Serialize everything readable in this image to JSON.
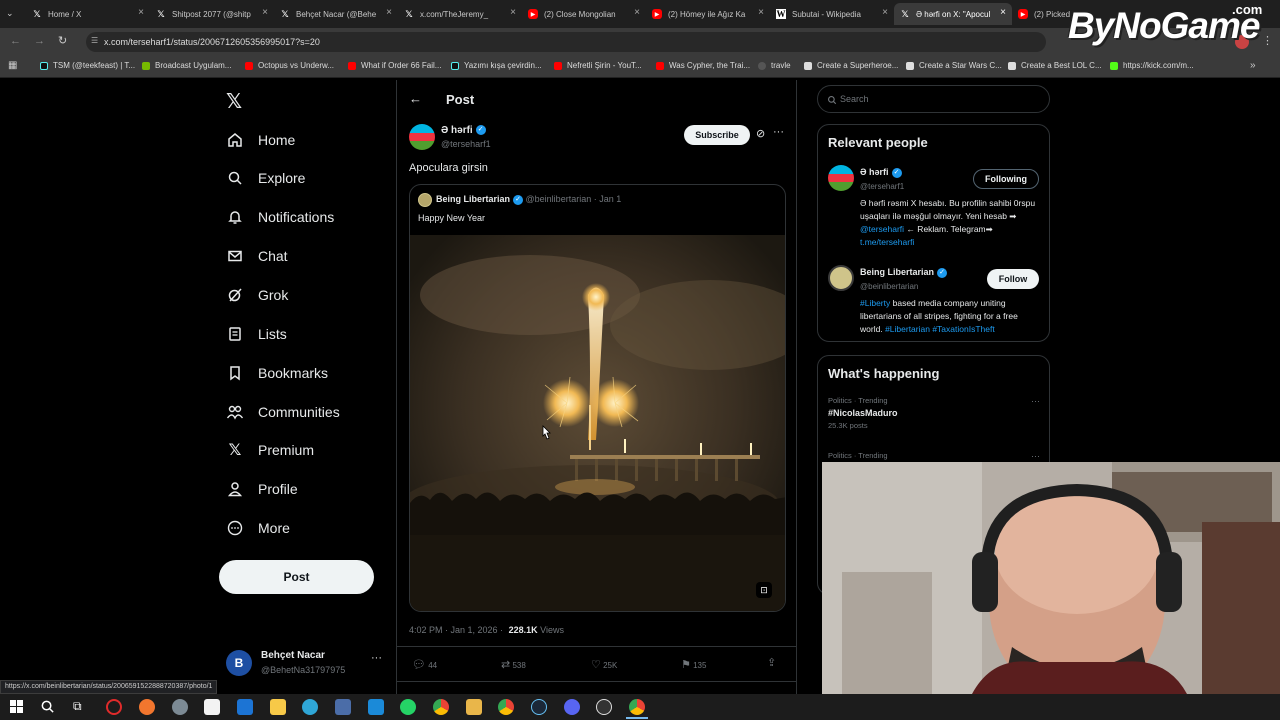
{
  "browser": {
    "tabs": [
      {
        "title": "Home / X",
        "fav": "x-icon",
        "color": "#000000"
      },
      {
        "title": "Shitpost 2077 (@shitp",
        "fav": "x-icon",
        "color": "#000000"
      },
      {
        "title": "Behçet Nacar (@Behe",
        "fav": "x-icon",
        "color": "#000000"
      },
      {
        "title": "x.com/TheJeremy_",
        "fav": "x-icon",
        "color": "#000000"
      },
      {
        "title": "(2) Close Mongolian",
        "fav": "youtube-icon",
        "color": "#ff0000"
      },
      {
        "title": "(2) Hömey ile Ağız Ka",
        "fav": "youtube-icon",
        "color": "#ff0000"
      },
      {
        "title": "Subutai - Wikipedia",
        "fav": "wikipedia-icon",
        "color": "#ffffff"
      },
      {
        "title": "Ə hərfi on X: \"Apocul",
        "fav": "x-icon",
        "color": "#000000"
      },
      {
        "title": "(2) Picked up",
        "fav": "youtube-icon",
        "color": "#ff0000"
      }
    ],
    "url": "x.com/terseharf1/status/2006712605356995017?s=20",
    "bookmarks": [
      {
        "label": "TSM (@teekfeast) | T..."
      },
      {
        "label": "Broadcast Uygulam..."
      },
      {
        "label": "Octopus vs Underw..."
      },
      {
        "label": "What if Order 66 Fail..."
      },
      {
        "label": "Yazımı kışa çevirdin..."
      },
      {
        "label": "Nefretli Şirin - YouT..."
      },
      {
        "label": "Was Cypher, the Trai..."
      },
      {
        "label": "travle"
      },
      {
        "label": "Create a Superheroe..."
      },
      {
        "label": "Create a Star Wars C..."
      },
      {
        "label": "Create a Best LOL C..."
      },
      {
        "label": "https://kick.com/m..."
      }
    ],
    "status_url": "https://x.com/beinlibertarian/status/2006591522888720387/photo/1"
  },
  "watermark": "ByNoGame",
  "watermark_tld": ".com",
  "nav": {
    "items": [
      {
        "label": "Home",
        "icon": "home-icon"
      },
      {
        "label": "Explore",
        "icon": "search-icon"
      },
      {
        "label": "Notifications",
        "icon": "bell-icon"
      },
      {
        "label": "Chat",
        "icon": "mail-icon"
      },
      {
        "label": "Grok",
        "icon": "grok-icon"
      },
      {
        "label": "Lists",
        "icon": "list-icon"
      },
      {
        "label": "Bookmarks",
        "icon": "bookmark-icon"
      },
      {
        "label": "Communities",
        "icon": "people-icon"
      },
      {
        "label": "Premium",
        "icon": "x-icon"
      },
      {
        "label": "Profile",
        "icon": "person-icon"
      },
      {
        "label": "More",
        "icon": "more-circle-icon"
      }
    ],
    "post_label": "Post",
    "account": {
      "initial": "B",
      "name": "Behçet Nacar",
      "handle": "@BehetNa31797975"
    }
  },
  "post": {
    "header": "Post",
    "author_name": "Ə hərfi",
    "author_handle": "@terseharf1",
    "subscribe": "Subscribe",
    "text": "Apoculara girsin",
    "quoted": {
      "name": "Being Libertarian",
      "handle": "@beinlibertarian",
      "date": "· Jan 1",
      "text": "Happy New Year"
    },
    "meta_time": "4:02 PM · Jan 1, 2026 ·",
    "views_count": "228.1K",
    "views_label": "Views",
    "actions": {
      "replies": "44",
      "reposts": "538",
      "likes": "25K",
      "bookmarks": "135"
    }
  },
  "sidebar": {
    "search_placeholder": "Search",
    "relevant_title": "Relevant people",
    "people": [
      {
        "name": "Ə hərfi",
        "handle": "@terseharf1",
        "button": "Following",
        "bio": "Ə hərfi rəsmi X hesabı. Bu profilin sahibi 0rspu uşaqları ilə məşğul olmayır. Yeni hesab ➡",
        "bio_link1": "@terseharfi",
        "bio_mid": "← Reklam. Telegram➡",
        "bio_link2": "t.me/terseharfi"
      },
      {
        "name": "Being Libertarian",
        "handle": "@beinlibertarian",
        "button": "Follow",
        "bio_link1": "#Liberty",
        "bio": "based media company uniting libertarians of all stripes, fighting for a free world.",
        "bio_link2": "#Libertarian",
        "bio_link3": "#TaxationIsTheft"
      }
    ],
    "happening_title": "What's happening",
    "trends": [
      {
        "context": "Politics · Trending",
        "tag": "#NicolasMaduro",
        "posts": "25.3K posts"
      },
      {
        "context": "Politics · Trending"
      }
    ]
  }
}
